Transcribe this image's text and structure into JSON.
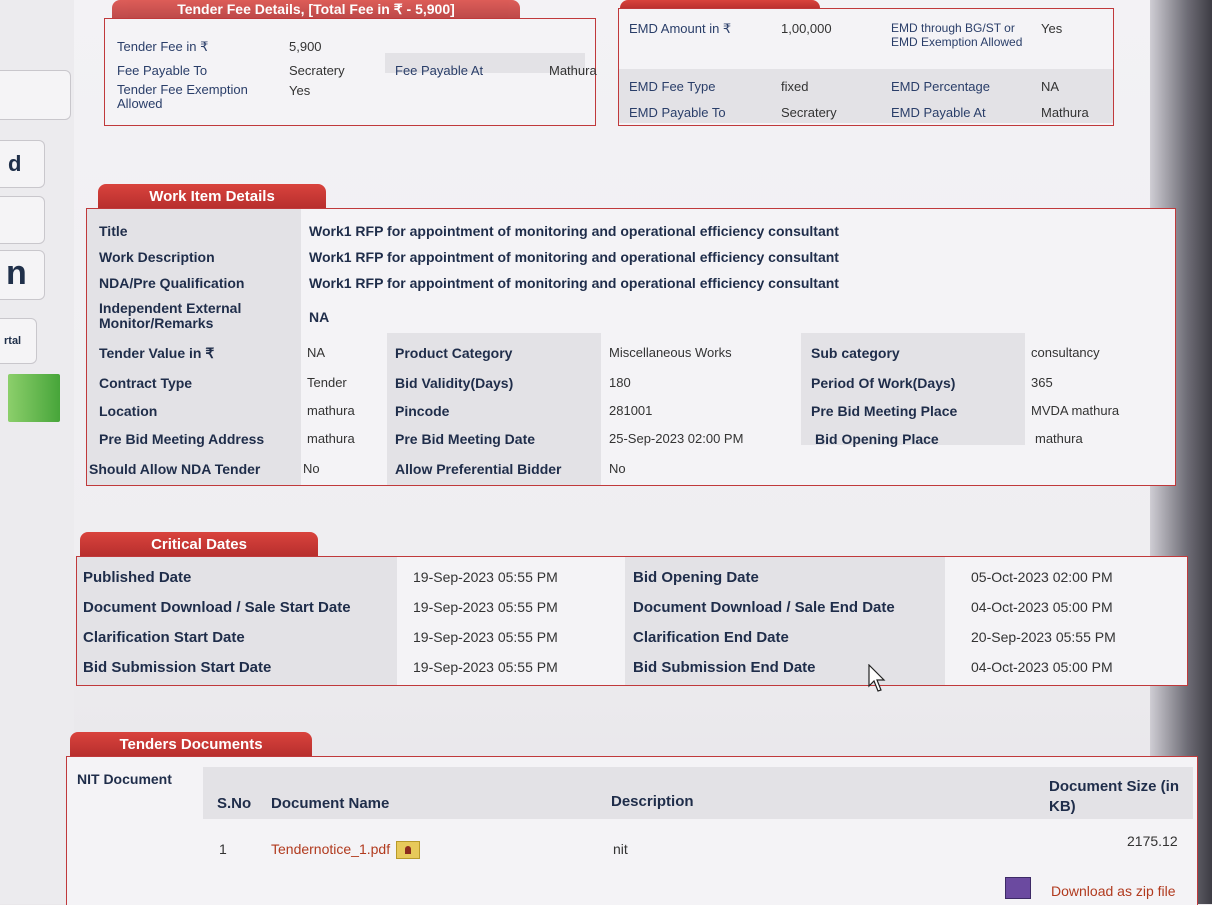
{
  "tender_fee": {
    "tab": "Tender Fee Details, [Total Fee in ₹ - 5,900]",
    "fee_label": "Tender Fee in ₹",
    "fee_value": "5,900",
    "payable_to_label": "Fee Payable To",
    "payable_to_value": "Secratery",
    "payable_at_label": "Fee Payable At",
    "payable_at_value": "Mathura",
    "exemption_label": "Tender Fee Exemption Allowed",
    "exemption_value": "Yes"
  },
  "emd": {
    "amount_label": "EMD Amount in ₹",
    "amount_value": "1,00,000",
    "through_label": "EMD through BG/ST or EMD Exemption Allowed",
    "through_value": "Yes",
    "fee_type_label": "EMD Fee Type",
    "fee_type_value": "fixed",
    "percentage_label": "EMD Percentage",
    "percentage_value": "NA",
    "payable_to_label": "EMD Payable To",
    "payable_to_value": "Secratery",
    "payable_at_label": "EMD Payable At",
    "payable_at_value": "Mathura"
  },
  "work_item": {
    "tab": "Work Item Details",
    "title_label": "Title",
    "title_value": "Work1 RFP for appointment of monitoring and operational efficiency consultant",
    "desc_label": "Work Description",
    "desc_value": "Work1 RFP for appointment of monitoring and operational efficiency consultant",
    "nda_label": "NDA/Pre Qualification",
    "nda_value": "Work1 RFP for appointment of monitoring and operational efficiency consultant",
    "monitor_label": "Independent External Monitor/Remarks",
    "monitor_value": "NA",
    "tender_value_label": "Tender Value in ₹",
    "tender_value": "NA",
    "product_cat_label": "Product Category",
    "product_cat_value": "Miscellaneous Works",
    "sub_cat_label": "Sub category",
    "sub_cat_value": "consultancy",
    "contract_label": "Contract Type",
    "contract_value": "Tender",
    "bid_validity_label": "Bid Validity(Days)",
    "bid_validity_value": "180",
    "period_label": "Period Of Work(Days)",
    "period_value": "365",
    "location_label": "Location",
    "location_value": "mathura",
    "pincode_label": "Pincode",
    "pincode_value": "281001",
    "prebid_place_label": "Pre Bid Meeting Place",
    "prebid_place_value": "MVDA mathura",
    "prebid_addr_label": "Pre Bid Meeting Address",
    "prebid_addr_value": "mathura",
    "prebid_date_label": "Pre Bid Meeting Date",
    "prebid_date_value": "25-Sep-2023 02:00 PM",
    "bid_open_place_label": "Bid Opening Place",
    "bid_open_place_value": "mathura",
    "allow_nda_label": "Should Allow NDA Tender",
    "allow_nda_value": "No",
    "pref_bidder_label": "Allow Preferential Bidder",
    "pref_bidder_value": "No"
  },
  "critical_dates": {
    "tab": "Critical Dates",
    "rows": [
      {
        "l1": "Published Date",
        "v1": "19-Sep-2023 05:55 PM",
        "l2": "Bid Opening Date",
        "v2": "05-Oct-2023 02:00 PM"
      },
      {
        "l1": "Document Download / Sale Start Date",
        "v1": "19-Sep-2023 05:55 PM",
        "l2": "Document Download / Sale End Date",
        "v2": "04-Oct-2023 05:00 PM"
      },
      {
        "l1": "Clarification Start Date",
        "v1": "19-Sep-2023 05:55 PM",
        "l2": "Clarification End Date",
        "v2": "20-Sep-2023 05:55 PM"
      },
      {
        "l1": "Bid Submission Start Date",
        "v1": "19-Sep-2023 05:55 PM",
        "l2": "Bid Submission End Date",
        "v2": "04-Oct-2023 05:00 PM"
      }
    ]
  },
  "documents": {
    "tab": "Tenders Documents",
    "nit_label": "NIT Document",
    "col_sno": "S.No",
    "col_name": "Document Name",
    "col_desc": "Description",
    "col_size": "Document Size (in KB)",
    "row": {
      "sno": "1",
      "name": "Tendernotice_1.pdf",
      "desc": "nit",
      "size": "2175.12"
    },
    "zip_label": "Download as zip file"
  },
  "sidebar": {
    "tile1": "d",
    "tile2": "n",
    "tile3": "rtal"
  }
}
